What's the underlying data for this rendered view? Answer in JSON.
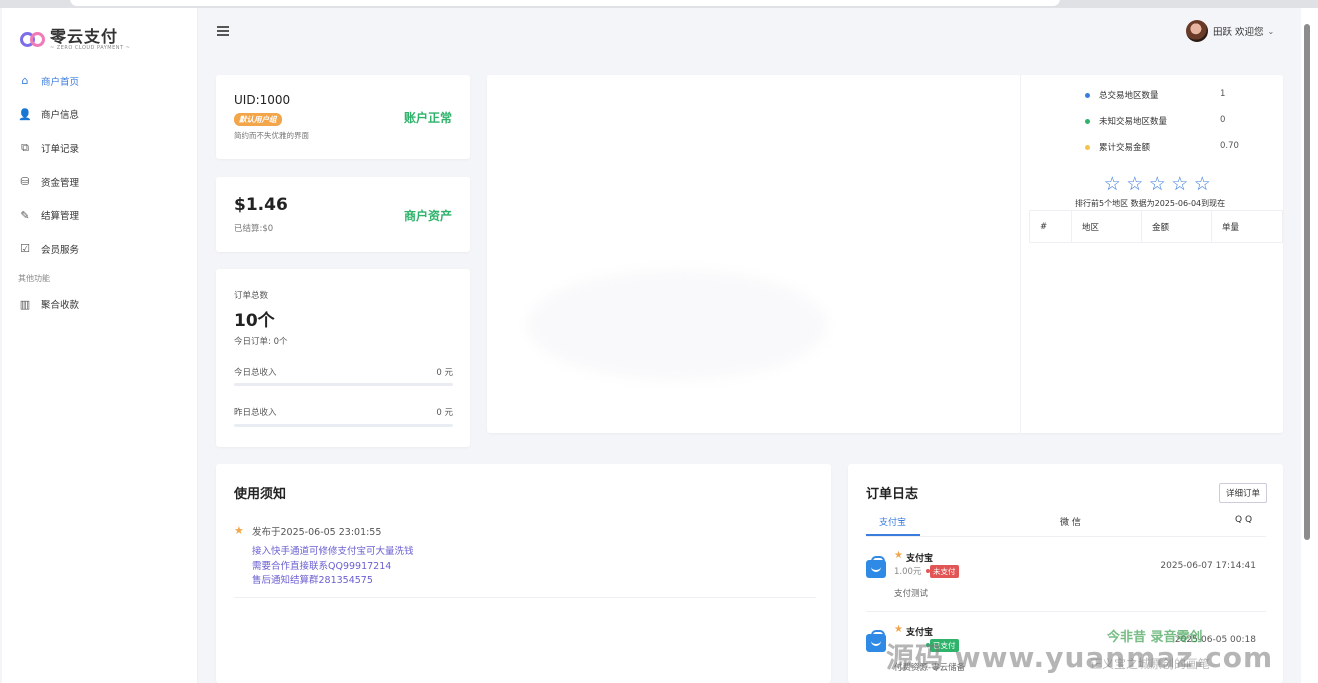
{
  "brand": {
    "title": "零云支付",
    "subtitle": "~ ZERO CLOUD PAYMENT ~"
  },
  "sidebar": {
    "items": [
      {
        "label": "商户首页",
        "icon": "home-icon",
        "active": true
      },
      {
        "label": "商户信息",
        "icon": "users-icon"
      },
      {
        "label": "订单记录",
        "icon": "order-icon"
      },
      {
        "label": "资金管理",
        "icon": "funds-icon"
      },
      {
        "label": "结算管理",
        "icon": "edit-icon"
      },
      {
        "label": "会员服务",
        "icon": "check-icon"
      }
    ],
    "section_label": "其他功能",
    "extra_items": [
      {
        "label": "聚合收款",
        "icon": "barcode-icon"
      }
    ]
  },
  "header": {
    "user_name": "田跃 欢迎您",
    "caret": "⌄"
  },
  "account_card": {
    "uid": "UID:1000",
    "badge": "默认用户组",
    "desc": "简约而不失优雅的界面",
    "status": "账户正常"
  },
  "asset_card": {
    "amount": "$1.46",
    "settled": "已结算:$0",
    "label": "商户资产"
  },
  "orders_card": {
    "label": "订单总数",
    "total": "10个",
    "today_orders": "今日订单:  0个",
    "today_income_label": "今日总收入",
    "today_income_value": "0 元",
    "yesterday_income_label": "昨日总收入",
    "yesterday_income_value": "0 元"
  },
  "region_stats": {
    "rows": [
      {
        "label": "总交易地区数量",
        "value": "1",
        "color": "#3b7ddd"
      },
      {
        "label": "未知交易地区数量",
        "value": "0",
        "color": "#2fb36b"
      },
      {
        "label": "累计交易金额",
        "value": "0.70",
        "color": "#f3c34a"
      }
    ],
    "stars": [
      "☆",
      "☆",
      "☆",
      "☆",
      "☆"
    ],
    "note": "排行前5个地区 数据为2025-06-04到现在",
    "table_headers": [
      "#",
      "地区",
      "金额",
      "单量"
    ]
  },
  "notice": {
    "title": "使用须知",
    "date": "发布于2025-06-05 23:01:55",
    "lines": [
      "接入快手通道可修修支付宝可大量洗钱",
      "需要合作直接联系QQ99917214",
      "售后通知结算群281354575"
    ]
  },
  "order_log": {
    "title": "订单日志",
    "detail_button": "详细订单",
    "tabs": [
      "支付宝",
      "微 信",
      "Q Q"
    ],
    "items": [
      {
        "name": "支付宝",
        "amount": "1.00元",
        "status": "未支付",
        "status_color": "#e25555",
        "time": "2025-06-07 17:14:41",
        "desc": "支付测试"
      },
      {
        "name": "支付宝",
        "amount": "",
        "status": "已支付",
        "status_color": "#2fb36b",
        "time": "2025-06-05 00:18",
        "desc": "付费资源-零云储备"
      }
    ]
  },
  "watermark": {
    "main": "源码 www.yuanmaz.com",
    "top": "今非昔 录音零创",
    "sub": "正义宝之城原创的画笔"
  }
}
